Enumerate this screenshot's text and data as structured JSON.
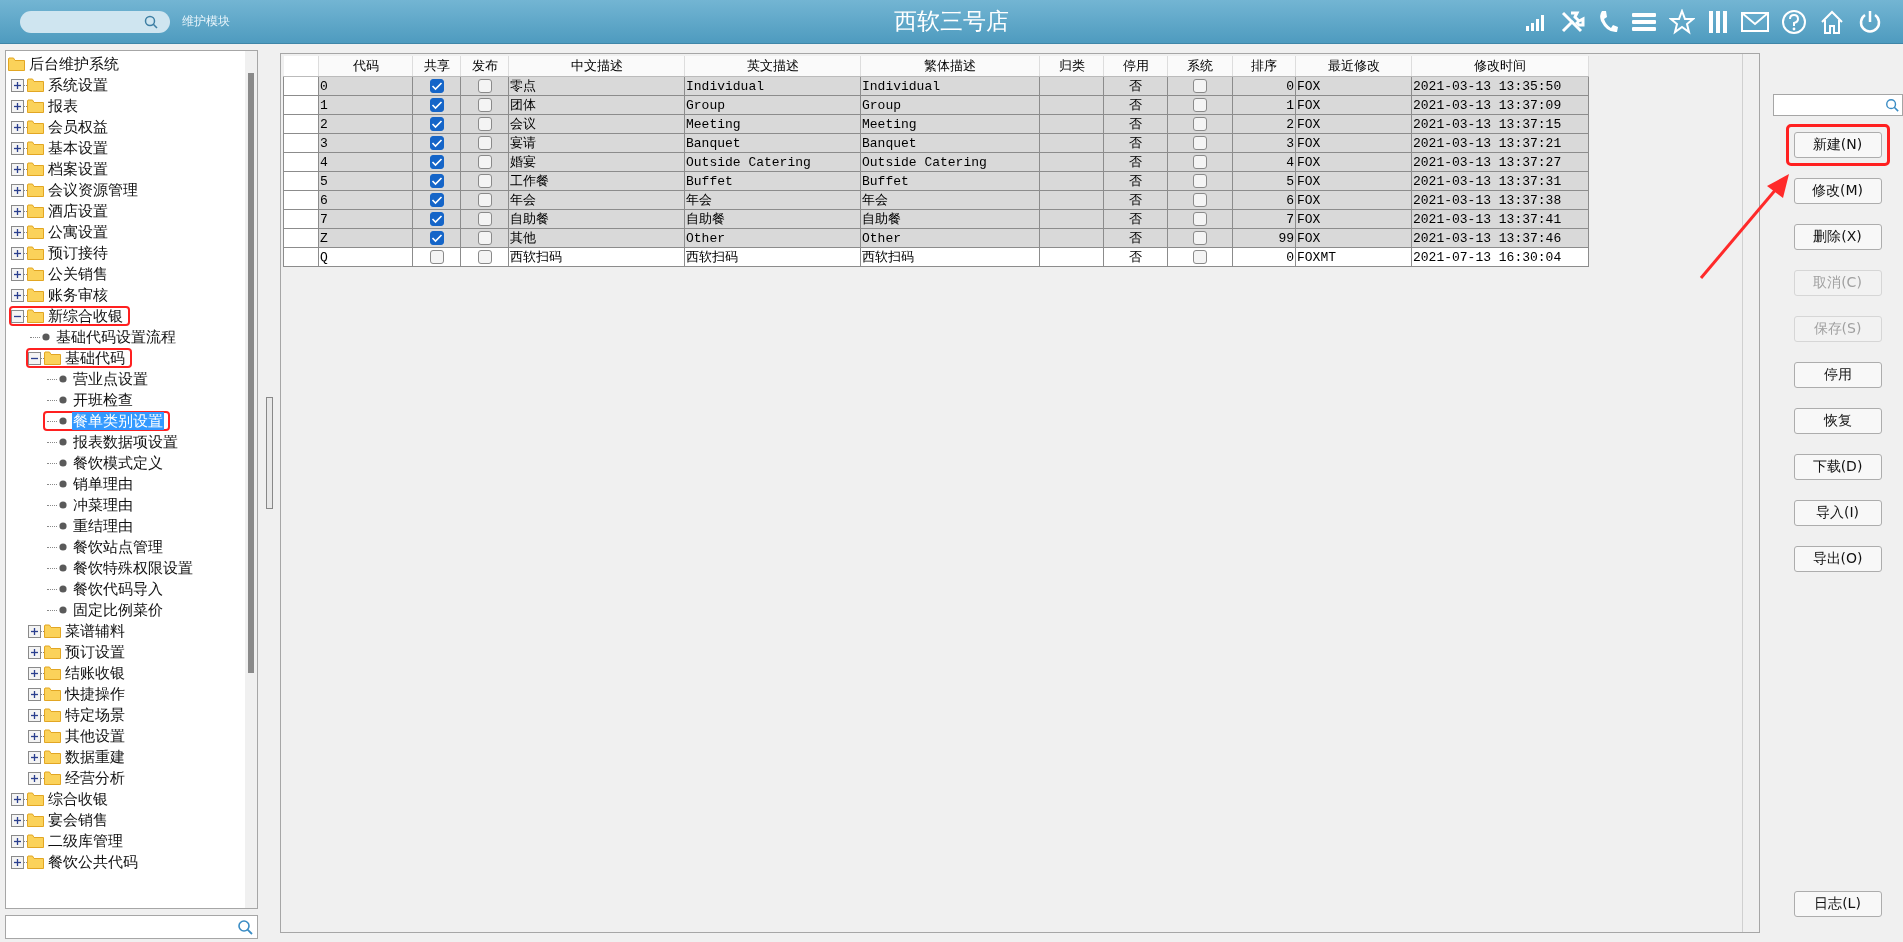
{
  "header": {
    "module_label": "维护模块",
    "title": "西软三号店"
  },
  "tree": {
    "items": [
      {
        "label": "后台维护系统",
        "kind": "folder",
        "selected": false,
        "boxed": false,
        "children": [
          {
            "label": "系统设置",
            "kind": "folder",
            "expanded": false,
            "selected": false,
            "boxed": false
          },
          {
            "label": "报表",
            "kind": "folder",
            "expanded": false,
            "selected": false,
            "boxed": false
          },
          {
            "label": "会员权益",
            "kind": "folder",
            "expanded": false,
            "selected": false,
            "boxed": false
          },
          {
            "label": "基本设置",
            "kind": "folder",
            "expanded": false,
            "selected": false,
            "boxed": false
          },
          {
            "label": "档案设置",
            "kind": "folder",
            "expanded": false,
            "selected": false,
            "boxed": false
          },
          {
            "label": "会议资源管理",
            "kind": "folder",
            "expanded": false,
            "selected": false,
            "boxed": false
          },
          {
            "label": "酒店设置",
            "kind": "folder",
            "expanded": false,
            "selected": false,
            "boxed": false
          },
          {
            "label": "公寓设置",
            "kind": "folder",
            "expanded": false,
            "selected": false,
            "boxed": false
          },
          {
            "label": "预订接待",
            "kind": "folder",
            "expanded": false,
            "selected": false,
            "boxed": false
          },
          {
            "label": "公关销售",
            "kind": "folder",
            "expanded": false,
            "selected": false,
            "boxed": false
          },
          {
            "label": "账务审核",
            "kind": "folder",
            "expanded": false,
            "selected": false,
            "boxed": false
          },
          {
            "label": "新综合收银",
            "kind": "folder",
            "expanded": true,
            "selected": false,
            "boxed": true,
            "children": [
              {
                "label": "基础代码设置流程",
                "kind": "leaf",
                "selected": false,
                "boxed": false
              },
              {
                "label": "基础代码",
                "kind": "folder",
                "expanded": true,
                "selected": false,
                "boxed": true,
                "children": [
                  {
                    "label": "营业点设置",
                    "kind": "leaf",
                    "selected": false,
                    "boxed": false
                  },
                  {
                    "label": "开班检查",
                    "kind": "leaf",
                    "selected": false,
                    "boxed": false
                  },
                  {
                    "label": "餐单类别设置",
                    "kind": "leaf",
                    "selected": true,
                    "boxed": true
                  },
                  {
                    "label": "报表数据项设置",
                    "kind": "leaf",
                    "selected": false,
                    "boxed": false
                  },
                  {
                    "label": "餐饮模式定义",
                    "kind": "leaf",
                    "selected": false,
                    "boxed": false
                  },
                  {
                    "label": "销单理由",
                    "kind": "leaf",
                    "selected": false,
                    "boxed": false
                  },
                  {
                    "label": "冲菜理由",
                    "kind": "leaf",
                    "selected": false,
                    "boxed": false
                  },
                  {
                    "label": "重结理由",
                    "kind": "leaf",
                    "selected": false,
                    "boxed": false
                  },
                  {
                    "label": "餐饮站点管理",
                    "kind": "leaf",
                    "selected": false,
                    "boxed": false
                  },
                  {
                    "label": "餐饮特殊权限设置",
                    "kind": "leaf",
                    "selected": false,
                    "boxed": false
                  },
                  {
                    "label": "餐饮代码导入",
                    "kind": "leaf",
                    "selected": false,
                    "boxed": false
                  },
                  {
                    "label": "固定比例菜价",
                    "kind": "leaf",
                    "selected": false,
                    "boxed": false
                  }
                ]
              },
              {
                "label": "菜谱辅料",
                "kind": "folder",
                "expanded": false,
                "selected": false,
                "boxed": false
              },
              {
                "label": "预订设置",
                "kind": "folder",
                "expanded": false,
                "selected": false,
                "boxed": false
              },
              {
                "label": "结账收银",
                "kind": "folder",
                "expanded": false,
                "selected": false,
                "boxed": false
              },
              {
                "label": "快捷操作",
                "kind": "folder",
                "expanded": false,
                "selected": false,
                "boxed": false
              },
              {
                "label": "特定场景",
                "kind": "folder",
                "expanded": false,
                "selected": false,
                "boxed": false
              },
              {
                "label": "其他设置",
                "kind": "folder",
                "expanded": false,
                "selected": false,
                "boxed": false
              },
              {
                "label": "数据重建",
                "kind": "folder",
                "expanded": false,
                "selected": false,
                "boxed": false
              },
              {
                "label": "经营分析",
                "kind": "folder",
                "expanded": false,
                "selected": false,
                "boxed": false
              }
            ]
          },
          {
            "label": "综合收银",
            "kind": "folder",
            "expanded": false,
            "selected": false,
            "boxed": false
          },
          {
            "label": "宴会销售",
            "kind": "folder",
            "expanded": false,
            "selected": false,
            "boxed": false
          },
          {
            "label": "二级库管理",
            "kind": "folder",
            "expanded": false,
            "selected": false,
            "boxed": false
          },
          {
            "label": "餐饮公共代码",
            "kind": "folder",
            "expanded": false,
            "selected": false,
            "boxed": false
          }
        ]
      }
    ]
  },
  "table": {
    "columns": [
      "代码",
      "共享",
      "发布",
      "中文描述",
      "英文描述",
      "繁体描述",
      "归类",
      "停用",
      "系统",
      "排序",
      "最近修改",
      "修改时间"
    ],
    "rows": [
      {
        "code": "0",
        "shared": true,
        "published": false,
        "zh": "零点",
        "en": "Individual",
        "zht": "Individual",
        "stopped": "否",
        "system": false,
        "order": "0",
        "modifier": "FOX",
        "time": "2021-03-13 13:35:50",
        "highlighted": true
      },
      {
        "code": "1",
        "shared": true,
        "published": false,
        "zh": "团体",
        "en": "Group",
        "zht": "Group",
        "stopped": "否",
        "system": false,
        "order": "1",
        "modifier": "FOX",
        "time": "2021-03-13 13:37:09",
        "highlighted": true
      },
      {
        "code": "2",
        "shared": true,
        "published": false,
        "zh": "会议",
        "en": "Meeting",
        "zht": "Meeting",
        "stopped": "否",
        "system": false,
        "order": "2",
        "modifier": "FOX",
        "time": "2021-03-13 13:37:15",
        "highlighted": true
      },
      {
        "code": "3",
        "shared": true,
        "published": false,
        "zh": "宴请",
        "en": "Banquet",
        "zht": "Banquet",
        "stopped": "否",
        "system": false,
        "order": "3",
        "modifier": "FOX",
        "time": "2021-03-13 13:37:21",
        "highlighted": true
      },
      {
        "code": "4",
        "shared": true,
        "published": false,
        "zh": "婚宴",
        "en": "Outside Catering",
        "zht": "Outside Catering",
        "stopped": "否",
        "system": false,
        "order": "4",
        "modifier": "FOX",
        "time": "2021-03-13 13:37:27",
        "highlighted": true
      },
      {
        "code": "5",
        "shared": true,
        "published": false,
        "zh": "工作餐",
        "en": "Buffet",
        "zht": "Buffet",
        "stopped": "否",
        "system": false,
        "order": "5",
        "modifier": "FOX",
        "time": "2021-03-13 13:37:31",
        "highlighted": true
      },
      {
        "code": "6",
        "shared": true,
        "published": false,
        "zh": "年会",
        "en": "年会",
        "zht": "年会",
        "stopped": "否",
        "system": false,
        "order": "6",
        "modifier": "FOX",
        "time": "2021-03-13 13:37:38",
        "highlighted": true
      },
      {
        "code": "7",
        "shared": true,
        "published": false,
        "zh": "自助餐",
        "en": "自助餐",
        "zht": "自助餐",
        "stopped": "否",
        "system": false,
        "order": "7",
        "modifier": "FOX",
        "time": "2021-03-13 13:37:41",
        "highlighted": true
      },
      {
        "code": "Z",
        "shared": true,
        "published": false,
        "zh": "其他",
        "en": "Other",
        "zht": "Other",
        "stopped": "否",
        "system": false,
        "order": "99",
        "modifier": "FOX",
        "time": "2021-03-13 13:37:46",
        "highlighted": true
      },
      {
        "code": "Q",
        "shared": false,
        "published": false,
        "zh": "西软扫码",
        "en": "西软扫码",
        "zht": "西软扫码",
        "stopped": "否",
        "system": false,
        "order": "0",
        "modifier": "FOXMT",
        "time": "2021-07-13 16:30:04",
        "highlighted": false
      }
    ]
  },
  "buttons": [
    {
      "label": "新建(N)",
      "disabled": false,
      "boxed": true
    },
    {
      "label": "修改(M)",
      "disabled": false,
      "boxed": false
    },
    {
      "label": "删除(X)",
      "disabled": false,
      "boxed": false
    },
    {
      "label": "取消(C)",
      "disabled": true,
      "boxed": false
    },
    {
      "label": "保存(S)",
      "disabled": true,
      "boxed": false
    },
    {
      "label": "停用",
      "disabled": false,
      "boxed": false
    },
    {
      "label": "恢复",
      "disabled": false,
      "boxed": false
    },
    {
      "label": "下载(D)",
      "disabled": false,
      "boxed": false
    },
    {
      "label": "导入(I)",
      "disabled": false,
      "boxed": false
    },
    {
      "label": "导出(O)",
      "disabled": false,
      "boxed": false
    }
  ],
  "log_button": {
    "label": "日志(L)",
    "disabled": false
  }
}
